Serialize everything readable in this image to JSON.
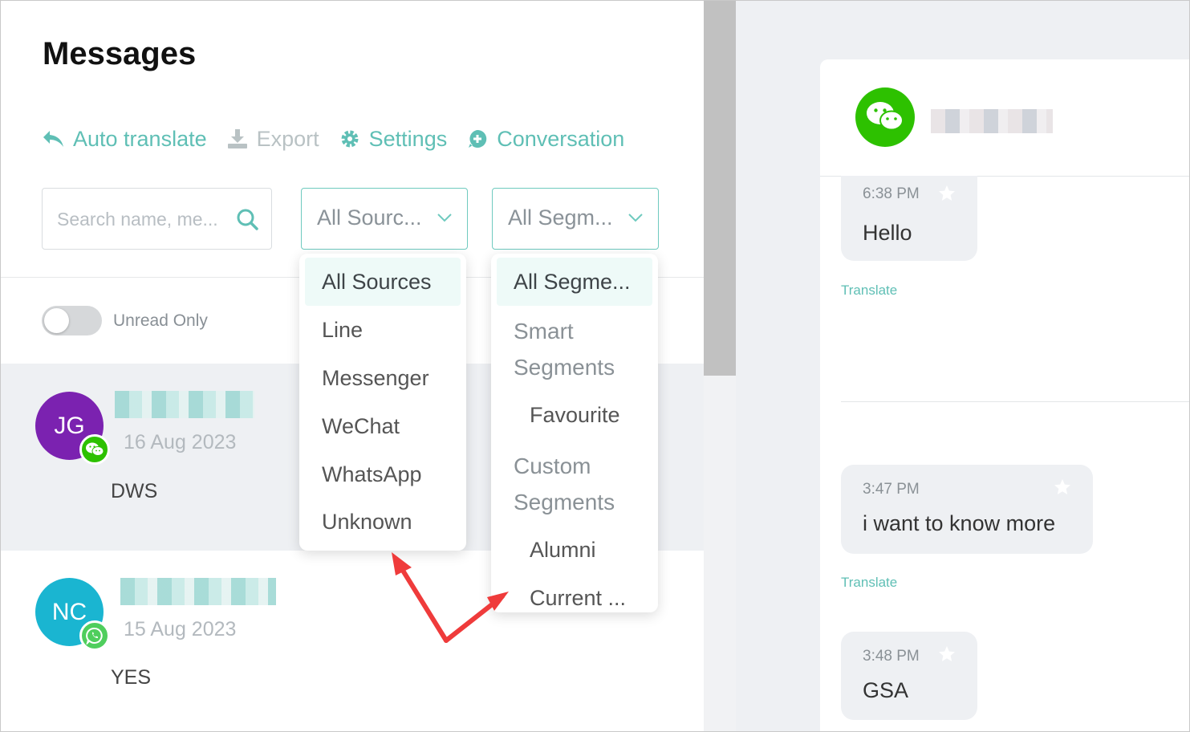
{
  "page": {
    "title": "Messages"
  },
  "toolbar": {
    "auto_translate": "Auto translate",
    "export": "Export",
    "settings": "Settings",
    "conversation": "Conversation"
  },
  "search": {
    "placeholder": "Search name, me..."
  },
  "filters": {
    "source_value": "All Sourc...",
    "segment_value": "All Segm..."
  },
  "source_menu": {
    "items": [
      "All Sources",
      "Line",
      "Messenger",
      "WeChat",
      "WhatsApp",
      "Unknown"
    ],
    "selected": "All Sources"
  },
  "segment_menu": {
    "selected": "All Segme...",
    "groups": [
      {
        "label_line1": "Smart",
        "label_line2": "Segments",
        "items": [
          "Favourite"
        ]
      },
      {
        "label_line1": "Custom",
        "label_line2": "Segments",
        "items": [
          "Alumni",
          "Current ..."
        ]
      }
    ]
  },
  "unread_toggle": {
    "label": "Unread Only",
    "on": false
  },
  "conversations": [
    {
      "initials": "JG",
      "date": "16 Aug 2023",
      "preview": "DWS",
      "channel": "wechat-icon",
      "avatar_color": "#7b22b0",
      "selected": true
    },
    {
      "initials": "NC",
      "date": "15 Aug 2023",
      "preview": "YES",
      "channel": "whatsapp-icon",
      "avatar_color": "#1ab5d1",
      "selected": false
    }
  ],
  "chat": {
    "channel": "wechat-icon",
    "messages": [
      {
        "time": "6:38 PM",
        "text": "Hello"
      },
      {
        "time": "3:47 PM",
        "text": "i want to know more"
      },
      {
        "time": "3:48 PM",
        "text": "GSA"
      }
    ],
    "translate_label": "Translate"
  },
  "colors": {
    "accent": "#5fbfb5",
    "wechat": "#2dc100",
    "whatsapp": "#4fce5d",
    "annotation_arrow": "#ef3b3b"
  }
}
